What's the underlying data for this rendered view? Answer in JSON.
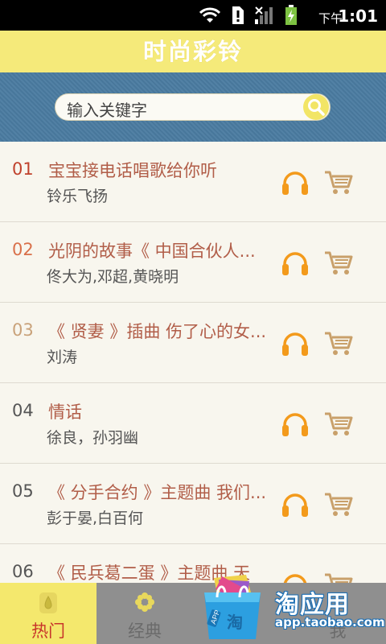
{
  "status_bar": {
    "ampm": "下午",
    "time": "1:01"
  },
  "header": {
    "title": "时尚彩铃"
  },
  "search": {
    "placeholder": "输入关键字"
  },
  "songs": [
    {
      "num": "01",
      "num_color": "#c0412c",
      "title": "宝宝接电话唱歌给你听",
      "artist": "铃乐飞扬"
    },
    {
      "num": "02",
      "num_color": "#d9704a",
      "title": "光阴的故事《 中国合伙人...",
      "artist": "佟大为,邓超,黄晓明"
    },
    {
      "num": "03",
      "num_color": "#c9a27a",
      "title": "《 贤妻 》插曲 伤了心的女...",
      "artist": "刘涛"
    },
    {
      "num": "04",
      "num_color": "#555555",
      "title": "情话",
      "artist": "徐良，孙羽幽"
    },
    {
      "num": "05",
      "num_color": "#555555",
      "title": "《 分手合约 》主题曲 我们...",
      "artist": "彭于晏,白百何"
    },
    {
      "num": "06",
      "num_color": "#555555",
      "title": "《 民兵葛二蛋 》主题曲 天",
      "artist": ""
    }
  ],
  "tabs": [
    {
      "label": "热门",
      "active": true
    },
    {
      "label": "经典",
      "active": false
    },
    {
      "label": "我",
      "active": false
    }
  ],
  "promo": {
    "brand": "淘应用",
    "url": "app.taobao.com",
    "badge": "APP",
    "bag_text": "淘"
  },
  "colors": {
    "accent_yellow": "#f4e86d",
    "headphone_orange": "#f39a1b",
    "cart_tan": "#c9a06a",
    "song_title": "#b15d48",
    "search_band": "#4b7ca1"
  }
}
